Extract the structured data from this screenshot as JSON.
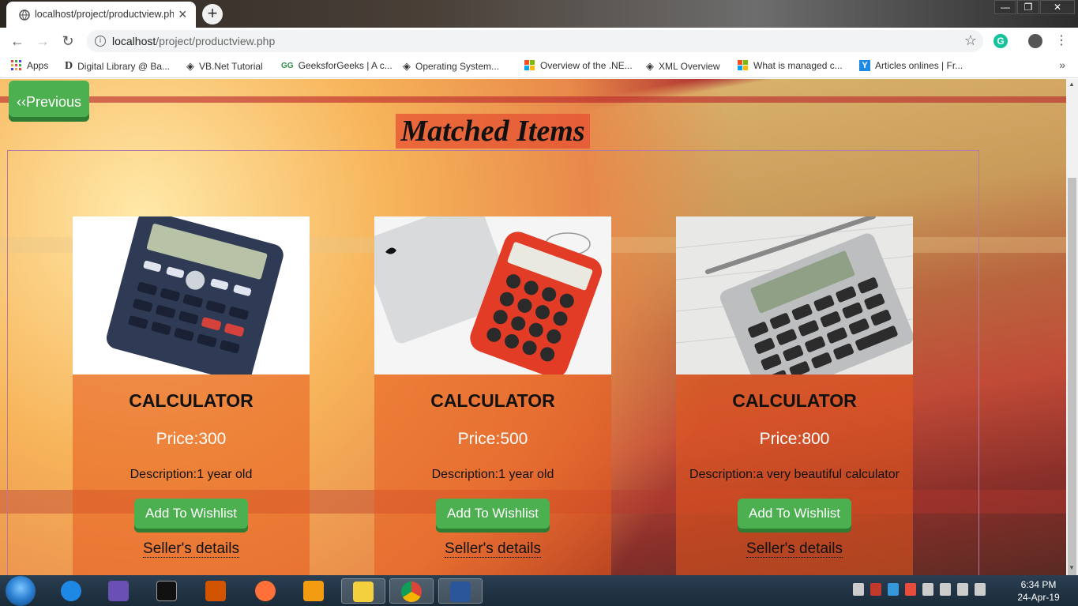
{
  "browser": {
    "tab_title": "localhost/project/productview.ph",
    "new_tab_label": "+",
    "address_host": "localhost",
    "address_path": "/project/productview.php",
    "window_buttons": [
      "—",
      "❐",
      "✕"
    ]
  },
  "bookmarks": [
    {
      "label": "Apps",
      "icon": "apps-grid-icon"
    },
    {
      "label": "Digital Library @ Ba...",
      "icon": "d-logo-icon"
    },
    {
      "label": "VB.Net Tutorial",
      "icon": "tutorial-icon"
    },
    {
      "label": "GeeksforGeeks | A c...",
      "icon": "gfg-icon"
    },
    {
      "label": "Operating System...",
      "icon": "tutorial-icon"
    },
    {
      "label": "Overview of the .NE...",
      "icon": "microsoft-icon"
    },
    {
      "label": "XML Overview",
      "icon": "tutorial-icon"
    },
    {
      "label": "What is managed c...",
      "icon": "microsoft-icon"
    },
    {
      "label": "Articles onlines | Fr...",
      "icon": "y-icon"
    }
  ],
  "page": {
    "previous_label": "‹‹Previous",
    "heading": "Matched Items",
    "products": [
      {
        "name": "CALCULATOR",
        "price": "Price:300",
        "description": "Description:1 year old",
        "wishlist_label": "Add To Wishlist",
        "seller_label": "Seller's details"
      },
      {
        "name": "CALCULATOR",
        "price": "Price:500",
        "description": "Description:1 year old",
        "wishlist_label": "Add To Wishlist",
        "seller_label": "Seller's details"
      },
      {
        "name": "CALCULATOR",
        "price": "Price:800",
        "description": "Description:a very beautiful calculator",
        "wishlist_label": "Add To Wishlist",
        "seller_label": "Seller's details"
      }
    ]
  },
  "taskbar": {
    "time": "6:34 PM",
    "date": "24-Apr-19"
  },
  "colors": {
    "button_green": "#4caf50",
    "button_shadow": "#2e7d32",
    "card_overlay": "#e65a1e"
  }
}
